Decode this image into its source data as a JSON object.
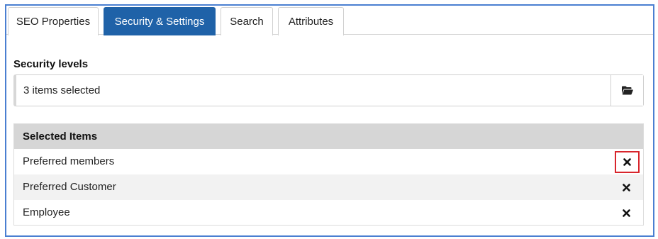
{
  "tabs": [
    {
      "label": "SEO Properties",
      "active": false
    },
    {
      "label": "Security & Settings",
      "active": true
    },
    {
      "label": "Search",
      "active": false
    },
    {
      "label": "Attributes",
      "active": false
    }
  ],
  "security": {
    "label": "Security levels",
    "selected_text": "3 items selected",
    "browse_icon": "folder-open-icon"
  },
  "selected_items": {
    "header": "Selected Items",
    "rows": [
      {
        "label": "Preferred members",
        "remove_icon": "remove-icon"
      },
      {
        "label": "Preferred Customer",
        "remove_icon": "remove-icon"
      },
      {
        "label": "Employee",
        "remove_icon": "remove-icon"
      }
    ]
  },
  "colors": {
    "frame_border": "#4a7fd1",
    "active_tab": "#1f62a8",
    "highlight": "#d8252c",
    "table_header": "#d6d6d6"
  }
}
